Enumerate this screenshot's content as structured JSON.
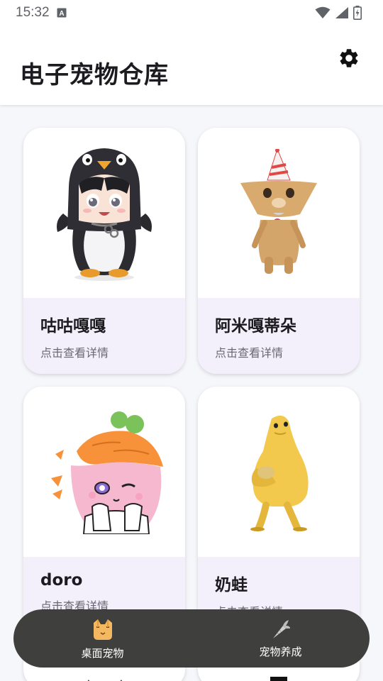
{
  "status_bar": {
    "time": "15:32",
    "notification_icon": "a-letter-icon",
    "icons": [
      "wifi-icon",
      "signal-icon",
      "battery-charging-icon"
    ]
  },
  "header": {
    "title": "电子宠物仓库",
    "settings_icon": "gear-icon"
  },
  "pets": [
    {
      "name": "咕咕嘎嘎",
      "subtitle": "点击查看详情",
      "image": "penguin-girl-sticker"
    },
    {
      "name": "阿米嘎蒂朵",
      "subtitle": "点击查看详情",
      "image": "party-hat-cat-sticker"
    },
    {
      "name": "doro",
      "subtitle": "点击查看详情",
      "image": "carrot-hat-girl-sticker"
    },
    {
      "name": "奶蛙",
      "subtitle": "点击查看详情",
      "image": "yellow-frog-sticker"
    }
  ],
  "bottom_nav": {
    "items": [
      {
        "label": "桌面宠物",
        "icon": "cat-face-icon"
      },
      {
        "label": "宠物养成",
        "icon": "carrot-icon"
      }
    ]
  }
}
